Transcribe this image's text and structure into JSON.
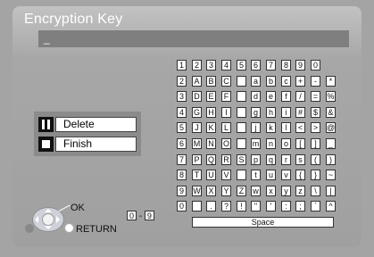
{
  "title": "Encryption Key",
  "entry_value": "_",
  "actions": {
    "delete_label": "Delete",
    "finish_label": "Finish"
  },
  "keyboard": {
    "rows": [
      [
        "1",
        "2",
        "3",
        "4",
        "5",
        "6",
        "7",
        "8",
        "9",
        "0"
      ],
      [
        "2",
        "A",
        "B",
        "C",
        "",
        "a",
        "b",
        "c",
        "+",
        "-",
        "*"
      ],
      [
        "3",
        "D",
        "E",
        "F",
        "",
        "d",
        "e",
        "f",
        "/",
        "=",
        "%"
      ],
      [
        "4",
        "G",
        "H",
        "I",
        "",
        "g",
        "h",
        "i",
        "#",
        "$",
        "&"
      ],
      [
        "5",
        "J",
        "K",
        "L",
        "",
        "j",
        "k",
        "l",
        "<",
        ">",
        "@"
      ],
      [
        "6",
        "M",
        "N",
        "O",
        "",
        "m",
        "n",
        "o",
        "[",
        "]",
        "_"
      ],
      [
        "7",
        "P",
        "Q",
        "R",
        "S",
        "p",
        "q",
        "r",
        "s",
        "(",
        ")"
      ],
      [
        "8",
        "T",
        "U",
        "V",
        "",
        "t",
        "u",
        "v",
        "{",
        "}",
        "~"
      ],
      [
        "9",
        "W",
        "X",
        "Y",
        "Z",
        "w",
        "x",
        "y",
        "z",
        "\\",
        "|"
      ],
      [
        "0",
        "",
        ".",
        "?",
        "!",
        "\"",
        "'",
        ":",
        ";",
        "`",
        "^"
      ]
    ],
    "space_label": "Space"
  },
  "hints": {
    "ok_label": "OK",
    "return_label": "RETURN",
    "num_from": "0",
    "num_sep": "-",
    "num_to": "9"
  },
  "icons": [
    "pause-icon",
    "stop-icon",
    "nav-pad-icon"
  ]
}
